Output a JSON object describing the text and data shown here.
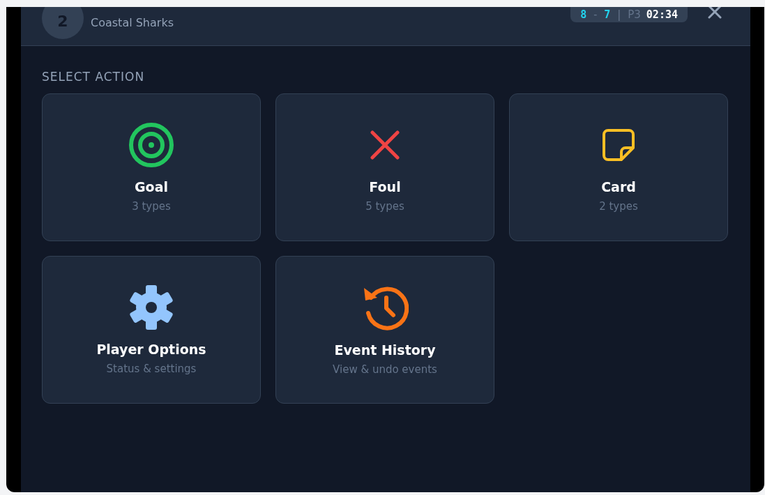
{
  "player": {
    "number": "2",
    "team": "Coastal Sharks"
  },
  "scoreboard": {
    "home": "8",
    "separator": "-",
    "away": "7",
    "divider": "|",
    "period": "P3",
    "clock": "02:34"
  },
  "section_title": "SELECT ACTION",
  "actions": [
    {
      "kind": "goal",
      "label": "Goal",
      "detail": "3 types"
    },
    {
      "kind": "foul",
      "label": "Foul",
      "detail": "5 types"
    },
    {
      "kind": "card",
      "label": "Card",
      "detail": "2 types"
    },
    {
      "kind": "options",
      "label": "Player Options",
      "detail": "Status & settings"
    },
    {
      "kind": "history",
      "label": "Event History",
      "detail": "View & undo events"
    }
  ]
}
